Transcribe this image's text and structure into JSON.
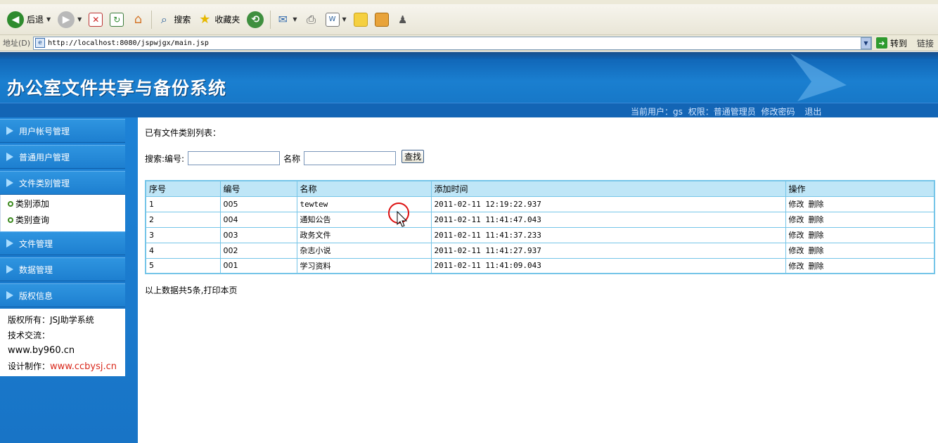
{
  "browser": {
    "toolbar": {
      "back_label": "后退",
      "search_label": "搜索",
      "favorites_label": "收藏夹"
    },
    "address": {
      "label": "地址(D)",
      "url": "http://localhost:8080/jspwjgx/main.jsp",
      "go_label": "转到",
      "links_label": "链接"
    }
  },
  "header": {
    "title": "办公室文件共享与备份系统",
    "user_info": {
      "current_user": "当前用户：gs",
      "permission": "权限：普通管理员",
      "change_password": "修改密码",
      "logout": "退出"
    }
  },
  "sidebar": {
    "items": [
      {
        "label": "用户帐号管理"
      },
      {
        "label": "普通用户管理"
      },
      {
        "label": "文件类别管理"
      },
      {
        "label": "文件管理"
      },
      {
        "label": "数据管理"
      },
      {
        "label": "版权信息"
      }
    ],
    "sub_items": [
      {
        "label": "类别添加"
      },
      {
        "label": "类别查询"
      }
    ],
    "copyright": {
      "owner": "版权所有：JSJ助学系统",
      "exchange": "技术交流：",
      "site": "www.by960.cn",
      "design_label": "设计制作：",
      "design_site": "www.ccbysj.cn"
    }
  },
  "main": {
    "list_title": "已有文件类别列表：",
    "search": {
      "prefix": "搜索:编号:",
      "code_value": "",
      "name_label": "名称",
      "name_value": "",
      "button": "查找"
    },
    "table": {
      "headers": [
        "序号",
        "编号",
        "名称",
        "添加时间",
        "操作"
      ],
      "rows": [
        {
          "index": "1",
          "code": "005",
          "name": "tewtew",
          "time": "2011-02-11 12:19:22.937"
        },
        {
          "index": "2",
          "code": "004",
          "name": "通知公告",
          "time": "2011-02-11 11:41:47.043"
        },
        {
          "index": "3",
          "code": "003",
          "name": "政务文件",
          "time": "2011-02-11 11:41:37.233"
        },
        {
          "index": "4",
          "code": "002",
          "name": "杂志小说",
          "time": "2011-02-11 11:41:27.937"
        },
        {
          "index": "5",
          "code": "001",
          "name": "学习资料",
          "time": "2011-02-11 11:41:09.043"
        }
      ],
      "edit_label": "修改",
      "delete_label": "删除"
    },
    "summary": "以上数据共5条,打印本页"
  }
}
